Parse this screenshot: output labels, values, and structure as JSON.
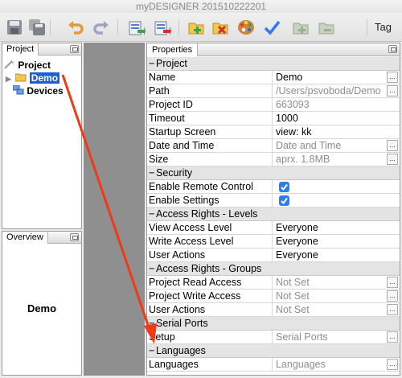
{
  "window": {
    "title": "myDESIGNER 201510222201"
  },
  "toolbar": {
    "items": [
      {
        "icon": "save-icon"
      },
      {
        "icon": "save-all-icon"
      },
      {
        "icon": "undo-icon"
      },
      {
        "icon": "redo-icon"
      },
      {
        "icon": "import-icon"
      },
      {
        "icon": "export-icon"
      },
      {
        "icon": "new-folder-icon"
      },
      {
        "icon": "delete-folder-icon"
      },
      {
        "icon": "palette-icon"
      },
      {
        "icon": "checkmark-icon"
      },
      {
        "icon": "folder-add-icon"
      },
      {
        "icon": "folder-remove-icon"
      }
    ],
    "tag_label": "Tag"
  },
  "project_panel": {
    "tab_label": "Project",
    "tree": {
      "root": "Project",
      "items": [
        "Demo",
        "Devices"
      ],
      "selected": "Demo"
    }
  },
  "overview_panel": {
    "tab_label": "Overview",
    "content": "Demo"
  },
  "properties_panel": {
    "tab_label": "Properties",
    "rows": [
      {
        "type": "section",
        "label": "Project"
      },
      {
        "type": "text",
        "name": "Name",
        "value": "Demo",
        "muted": false,
        "button": true
      },
      {
        "type": "text",
        "name": "Path",
        "value": "/Users/psvoboda/Demo",
        "muted": true,
        "button": true
      },
      {
        "type": "text",
        "name": "Project ID",
        "value": "663093",
        "muted": true,
        "button": false
      },
      {
        "type": "text",
        "name": "Timeout",
        "value": "1000",
        "muted": false,
        "button": false
      },
      {
        "type": "text",
        "name": "Startup Screen",
        "value": "view: kk",
        "muted": false,
        "button": false
      },
      {
        "type": "text",
        "name": "Date and Time",
        "value": "Date and Time",
        "muted": true,
        "button": true
      },
      {
        "type": "text",
        "name": "Size",
        "value": "aprx. 1.8MB",
        "muted": true,
        "button": true
      },
      {
        "type": "section",
        "label": "Security"
      },
      {
        "type": "check",
        "name": "Enable Remote Control",
        "checked": true
      },
      {
        "type": "check",
        "name": "Enable Settings",
        "checked": true
      },
      {
        "type": "section",
        "label": "Access Rights - Levels"
      },
      {
        "type": "text",
        "name": "View Access Level",
        "value": "Everyone",
        "muted": false,
        "button": false
      },
      {
        "type": "text",
        "name": "Write Access Level",
        "value": "Everyone",
        "muted": false,
        "button": false
      },
      {
        "type": "text",
        "name": "User Actions",
        "value": "Everyone",
        "muted": false,
        "button": false
      },
      {
        "type": "section",
        "label": "Access Rights - Groups"
      },
      {
        "type": "text",
        "name": "Project Read Access",
        "value": "Not Set",
        "muted": true,
        "button": true
      },
      {
        "type": "text",
        "name": "Project Write Access",
        "value": "Not Set",
        "muted": true,
        "button": true
      },
      {
        "type": "text",
        "name": "User Actions",
        "value": "Not Set",
        "muted": true,
        "button": true
      },
      {
        "type": "section",
        "label": "Serial Ports"
      },
      {
        "type": "text",
        "name": "Setup",
        "value": "Serial Ports",
        "muted": true,
        "button": true
      },
      {
        "type": "section",
        "label": "Languages"
      },
      {
        "type": "text",
        "name": "Languages",
        "value": "Languages",
        "muted": true,
        "button": true
      }
    ],
    "ellipsis_label": "..."
  },
  "colors": {
    "selection": "#1f5fd6",
    "checkbox": "#2d7cf4",
    "annotation_arrow": "#f03a17",
    "canvas_gray": "#8f8f8f"
  }
}
